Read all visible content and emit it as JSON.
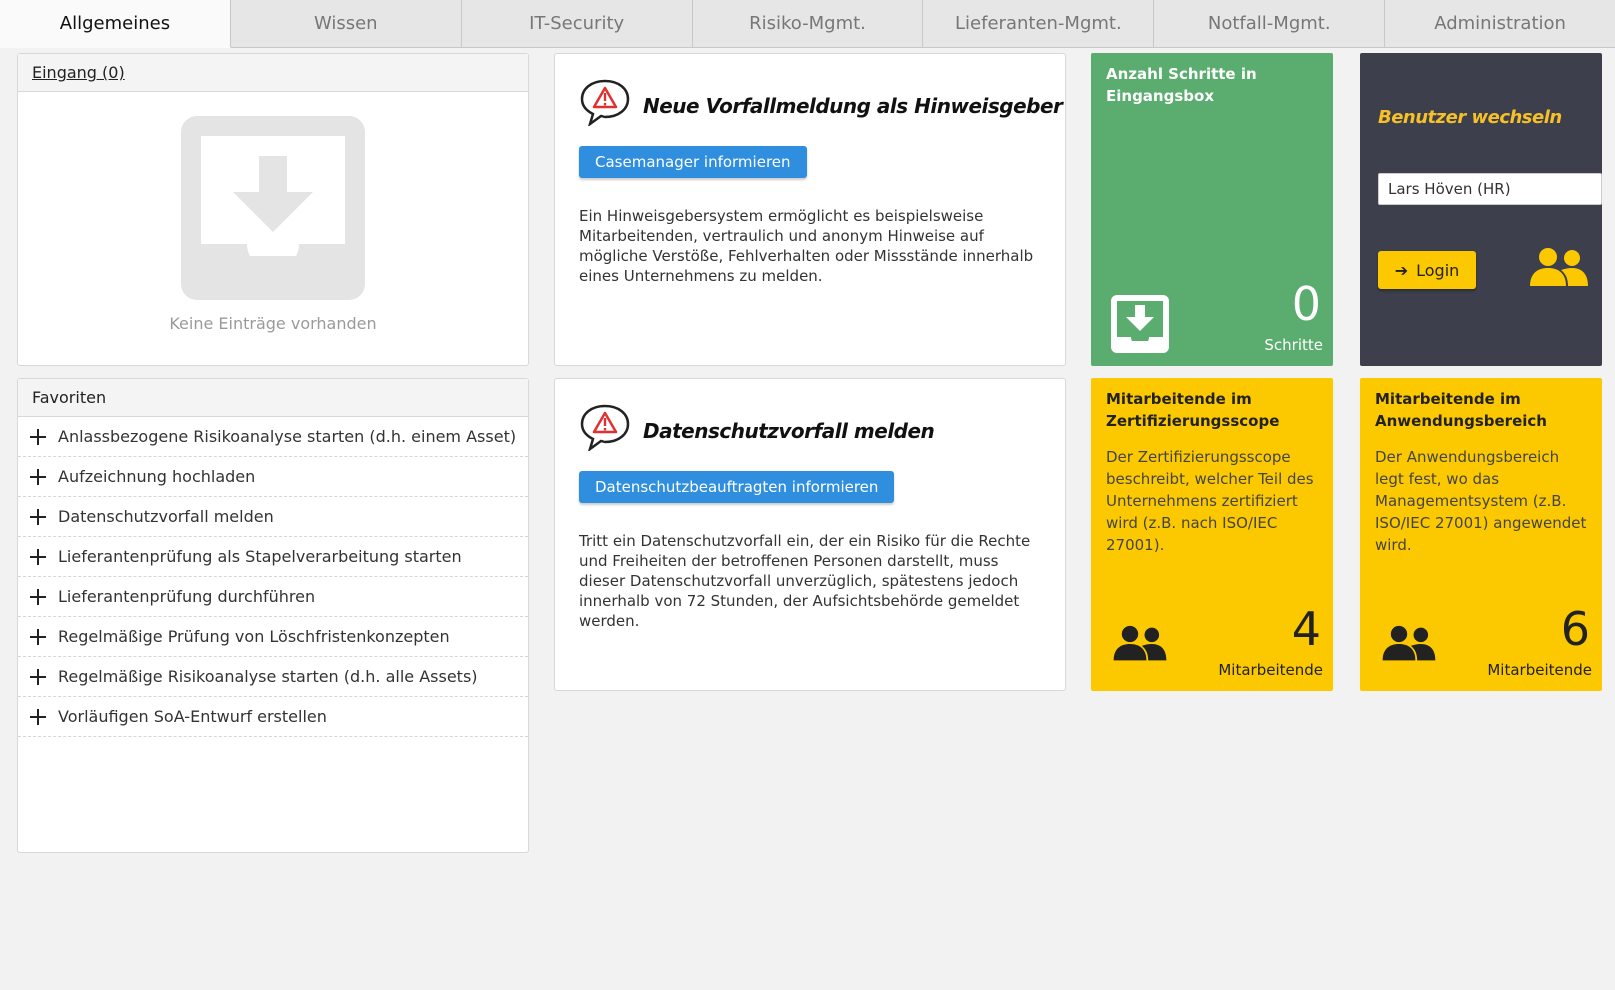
{
  "tabs": [
    {
      "label": "Allgemeines",
      "active": true
    },
    {
      "label": "Wissen"
    },
    {
      "label": "IT-Security"
    },
    {
      "label": "Risiko-Mgmt."
    },
    {
      "label": "Lieferanten-Mgmt."
    },
    {
      "label": "Notfall-Mgmt."
    },
    {
      "label": "Administration"
    }
  ],
  "inbox": {
    "header": "Eingang (0)",
    "empty_text": "Keine Einträge vorhanden",
    "icon": "inbox-download-icon"
  },
  "favorites": {
    "header": "Favoriten",
    "items": [
      "Anlassbezogene Risikoanalyse starten (d.h. einem Asset)",
      "Aufzeichnung hochladen",
      "Datenschutzvorfall melden",
      "Lieferantenprüfung als Stapelverarbeitung starten",
      "Lieferantenprüfung durchführen",
      "Regelmäßige Prüfung von Löschfristenkonzepten",
      "Regelmäßige Risikoanalyse starten (d.h. alle Assets)",
      "Vorläufigen SoA-Entwurf erstellen"
    ]
  },
  "cards": {
    "whistleblower": {
      "title": "Neue Vorfallmeldung als Hinweisgeber",
      "button": "Casemanager informieren",
      "text": "Ein Hinweisgebersystem ermöglicht es beispielsweise Mitarbeitenden, vertraulich und anonym Hinweise auf mögliche Verstöße, Fehlverhalten oder Missstände innerhalb eines Unternehmens zu melden.",
      "icon": "warning-speech-bubble-icon"
    },
    "privacy": {
      "title": "Datenschutzvorfall melden",
      "button": "Datenschutzbeauftragten informieren",
      "text": "Tritt ein Datenschutzvorfall ein, der ein Risiko für die Rechte und Freiheiten der betroffenen Personen darstellt, muss dieser Datenschutzvorfall unverzüglich, spätestens jedoch innerhalb von 72 Stunden, der Aufsichtsbehörde gemeldet werden.",
      "icon": "warning-speech-bubble-icon"
    }
  },
  "tiles": {
    "steps": {
      "title": "Anzahl Schritte in Eingangsbox",
      "value": "0",
      "unit": "Schritte",
      "color": "#5aad6e",
      "icon": "inbox-download-icon"
    },
    "switch_user": {
      "title": "Benutzer wechseln",
      "selected_user": "Lars Höven (HR)",
      "login_label": "Login",
      "color": "#3d3f4c",
      "accent": "#f6c029",
      "icon": "users-icon"
    },
    "cert_scope": {
      "title": "Mitarbeitende im Zertifizierungsscope",
      "text": "Der Zertifizierungsscope beschreibt, welcher Teil des Unternehmens zertifiziert wird (z.B. nach ISO/IEC 27001).",
      "value": "4",
      "unit": "Mitarbeitende",
      "color": "#fcc900",
      "icon": "users-icon"
    },
    "app_scope": {
      "title": "Mitarbeitende im Anwendungsbereich",
      "text": "Der Anwendungsbereich legt fest, wo das Managementsystem (z.B. ISO/IEC 27001) angewendet wird.",
      "value": "6",
      "unit": "Mitarbeitende",
      "color": "#fcc900",
      "icon": "users-icon"
    }
  }
}
